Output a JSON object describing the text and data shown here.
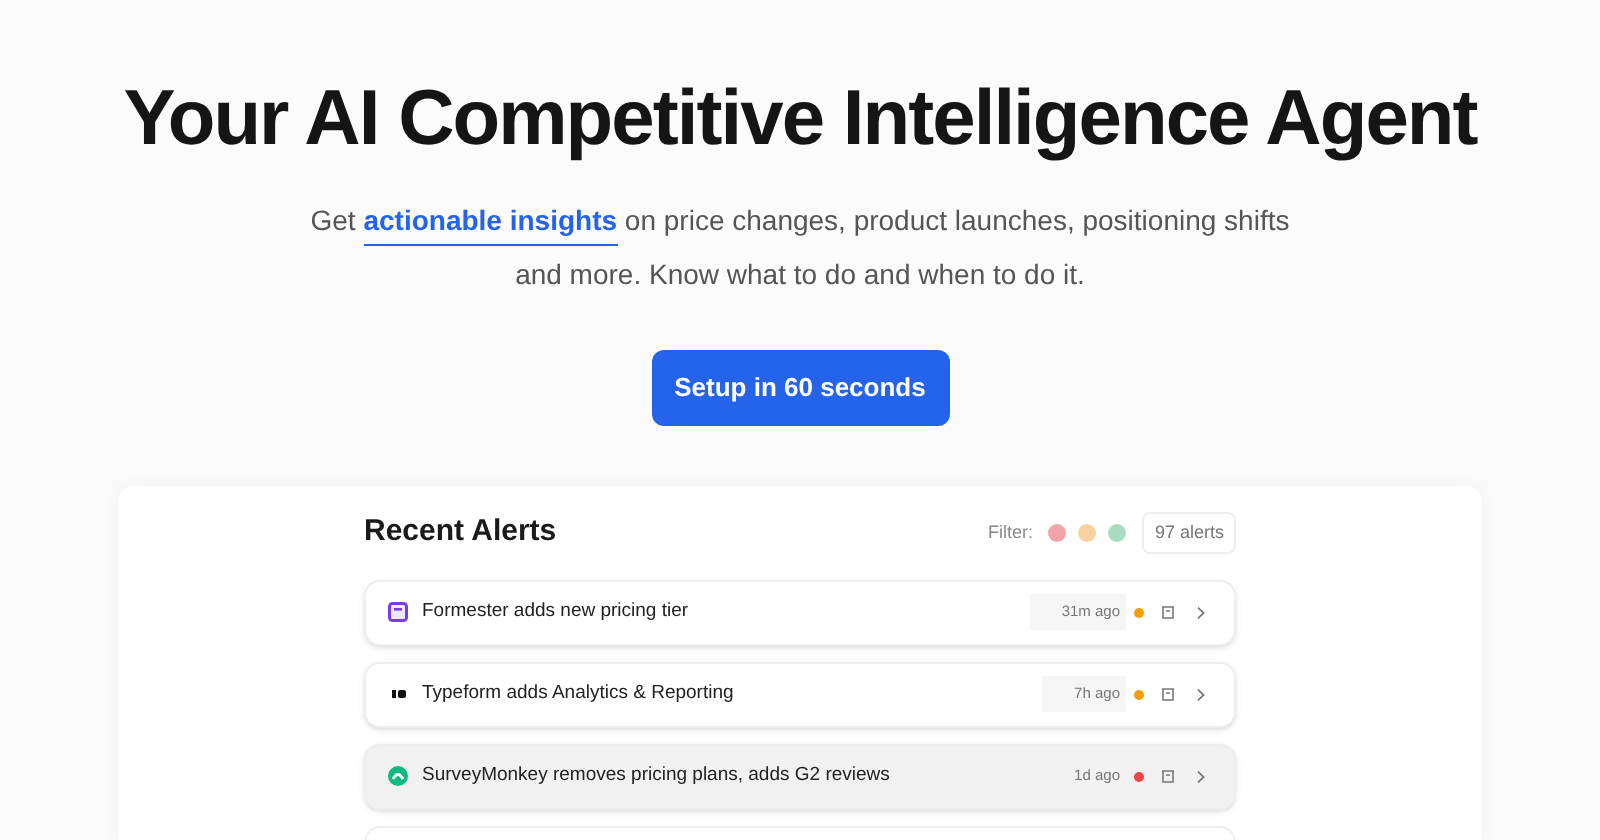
{
  "headline": "Your AI Competitive Intelligence Agent",
  "subtitle": {
    "before": "Get",
    "link": "actionable insights",
    "after": "on price changes, product launches, positioning shifts and more. Know what to do and when to do it."
  },
  "cta": "Setup in 60 seconds",
  "alerts_panel": {
    "title": "Recent Alerts",
    "filter_label": "Filter:",
    "filters": [
      {
        "color": "#f4a3a8"
      },
      {
        "color": "#f8d3a0"
      },
      {
        "color": "#a8dcc0"
      }
    ],
    "count": "97 alerts",
    "alerts": [
      {
        "kind": "form",
        "title": "Formester adds new pricing tier",
        "time": "31m ago",
        "color": "#f59e0b",
        "selected": false
      },
      {
        "kind": "bars",
        "title": "Typeform adds Analytics & Reporting",
        "time": "7h ago",
        "color": "#f59e0b",
        "selected": false
      },
      {
        "kind": "monkey",
        "title": "SurveyMonkey removes pricing plans, adds G2 reviews",
        "time": "1d ago",
        "color": "#ef4444",
        "selected": true
      }
    ]
  }
}
